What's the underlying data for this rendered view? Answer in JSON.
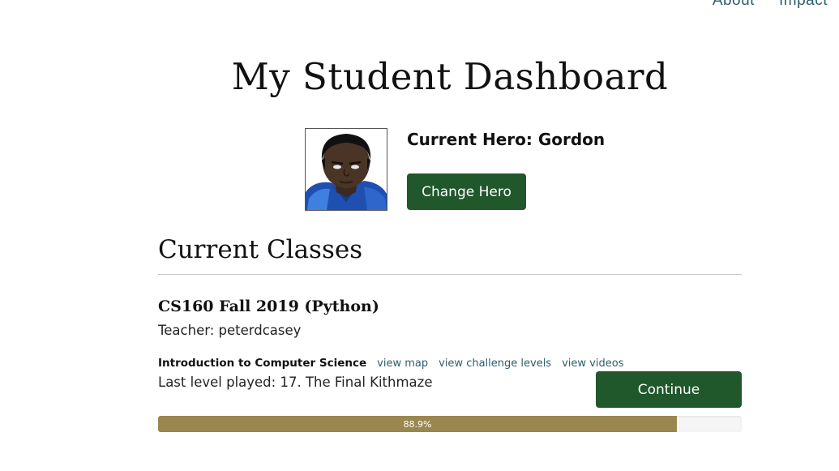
{
  "nav": {
    "items": [
      "About",
      "Impact"
    ]
  },
  "page": {
    "title": "My Student Dashboard"
  },
  "hero": {
    "label": "Current Hero: Gordon",
    "change_button": "Change Hero"
  },
  "classes": {
    "section_title": "Current Classes",
    "items": [
      {
        "name": "CS160 Fall 2019 (Python)",
        "teacher": "Teacher: peterdcasey",
        "course": "Introduction to Computer Science",
        "links": [
          "view map",
          "view challenge levels",
          "view videos"
        ],
        "last_level": "Last level played: 17. The Final Kithmaze",
        "continue_button": "Continue",
        "progress_label": "88.9%",
        "progress_fraction": 0.889
      }
    ]
  },
  "colors": {
    "button_green": "#20572b",
    "progress_fill": "#9a8750",
    "link": "#2f5d6b"
  },
  "icons": {
    "hero_portrait": "hero-portrait-gordon"
  }
}
